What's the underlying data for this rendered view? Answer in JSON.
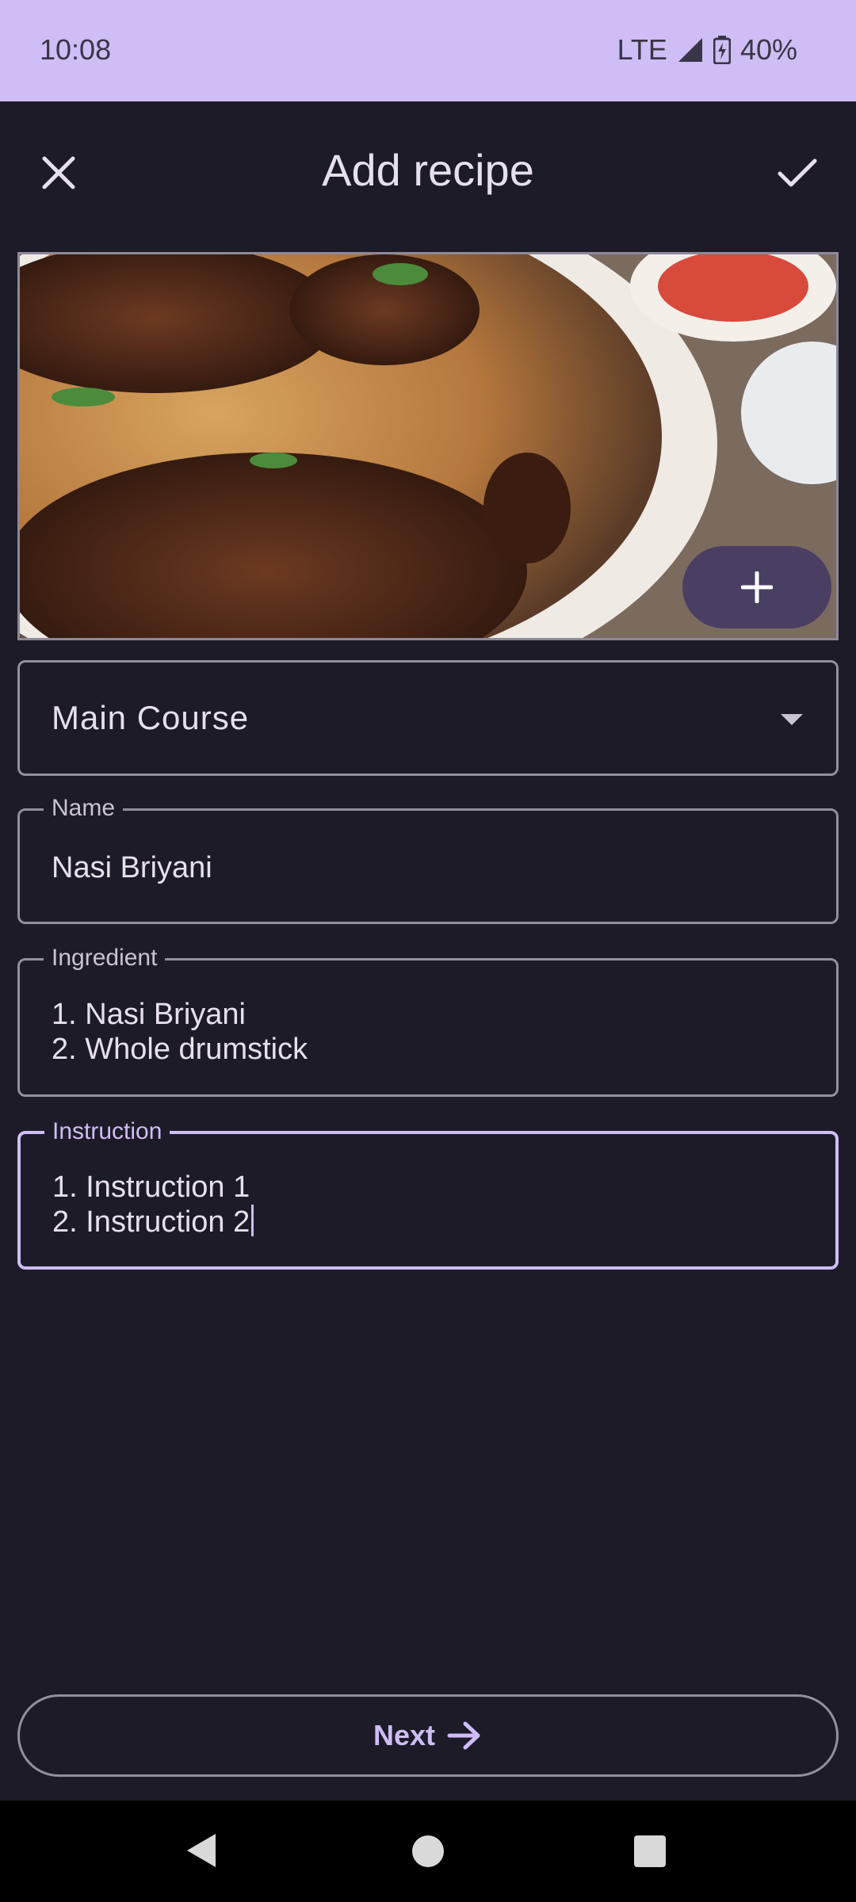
{
  "status": {
    "time": "10:08",
    "network": "LTE",
    "battery": "40%"
  },
  "header": {
    "title": "Add recipe",
    "close_icon": "close-icon",
    "confirm_icon": "check-icon"
  },
  "photo": {
    "add_icon": "plus-icon"
  },
  "form": {
    "category": {
      "value": "Main Course"
    },
    "name": {
      "label": "Name",
      "value": "Nasi Briyani"
    },
    "ingredient": {
      "label": "Ingredient",
      "value": "1. Nasi Briyani\n2. Whole drumstick"
    },
    "instruction": {
      "label": "Instruction",
      "value": "1. Instruction 1\n2. Instruction 2"
    }
  },
  "footer": {
    "next_label": "Next"
  },
  "colors": {
    "status_bar": "#cfbdf6",
    "background": "#1d1b27",
    "accent": "#cfbdf6",
    "fab": "#4a3e63"
  }
}
